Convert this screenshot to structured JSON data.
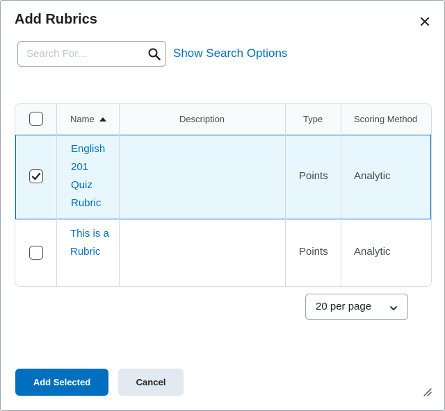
{
  "dialog": {
    "title": "Add Rubrics",
    "close_icon": "close-icon"
  },
  "search": {
    "placeholder": "Search For...",
    "value": "",
    "icon": "search-icon",
    "options_link": "Show Search Options"
  },
  "table": {
    "columns": [
      {
        "label": "",
        "type": "select-all-checkbox",
        "checked": false
      },
      {
        "label": "Name",
        "sort": "ascending",
        "sort_icon": "sort-up-icon"
      },
      {
        "label": "Description"
      },
      {
        "label": "Type"
      },
      {
        "label": "Scoring Method"
      }
    ],
    "rows": [
      {
        "selected": true,
        "name": "English 201 Quiz Rubric",
        "description": "",
        "type": "Points",
        "scoring_method": "Analytic"
      },
      {
        "selected": false,
        "name": "This is a Rubric",
        "description": "",
        "type": "Points",
        "scoring_method": "Analytic"
      }
    ]
  },
  "pager": {
    "selected": "20 per page",
    "icon": "chevron-down-icon"
  },
  "footer": {
    "add_label": "Add Selected",
    "cancel_label": "Cancel",
    "resize_icon": "resize-handle-icon"
  },
  "colors": {
    "accent": "#006fbf",
    "selected_row_bg": "#e8f7fe",
    "border": "#d6dadf",
    "text": "#494c4e"
  }
}
